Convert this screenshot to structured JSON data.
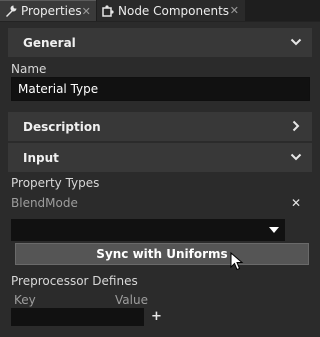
{
  "tabs": [
    {
      "label": "Properties",
      "icon": "wrench-icon",
      "active": true
    },
    {
      "label": "Node Components",
      "icon": "puzzle-icon",
      "active": false
    }
  ],
  "sections": {
    "general": {
      "title": "General",
      "expanded": true
    },
    "description": {
      "title": "Description",
      "expanded": false
    },
    "input": {
      "title": "Input",
      "expanded": true
    }
  },
  "name": {
    "label": "Name",
    "value": "Material Type"
  },
  "property_types": {
    "label": "Property Types",
    "item": "BlendMode",
    "select_value": "",
    "sync_button": "Sync with Uniforms"
  },
  "preprocessor": {
    "label": "Preprocessor Defines",
    "key_header": "Key",
    "value_header": "Value"
  },
  "colors": {
    "background": "#2b2b2b",
    "header": "#383838",
    "input": "#111111",
    "button": "#555555"
  }
}
